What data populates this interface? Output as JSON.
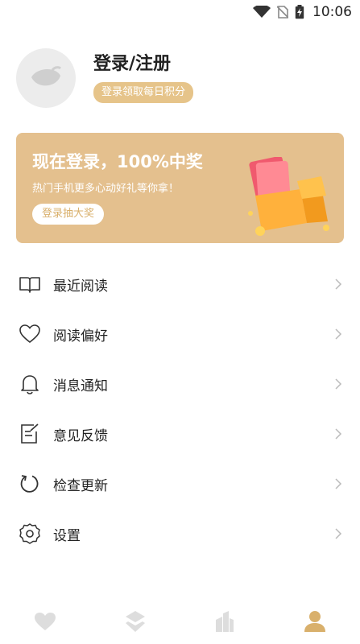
{
  "status": {
    "time": "10:06"
  },
  "profile": {
    "title": "登录/注册",
    "subtitle": "登录领取每日积分"
  },
  "banner": {
    "title": "现在登录，100%中奖",
    "subtitle": "热门手机更多心动好礼等你拿！",
    "button": "登录抽大奖"
  },
  "menu": {
    "items": [
      {
        "label": "最近阅读",
        "icon": "book-icon"
      },
      {
        "label": "阅读偏好",
        "icon": "heart-icon"
      },
      {
        "label": "消息通知",
        "icon": "bell-icon"
      },
      {
        "label": "意见反馈",
        "icon": "feedback-icon"
      },
      {
        "label": "检查更新",
        "icon": "refresh-icon"
      },
      {
        "label": "设置",
        "icon": "gear-icon"
      }
    ]
  },
  "nav": {
    "items": [
      "heart-icon",
      "layers-icon",
      "buildings-icon",
      "person-icon"
    ],
    "active_color": "#d9b06c",
    "inactive_color": "#dddddd"
  },
  "colors": {
    "accent": "#e4c08e",
    "badge": "#e6c48a"
  }
}
